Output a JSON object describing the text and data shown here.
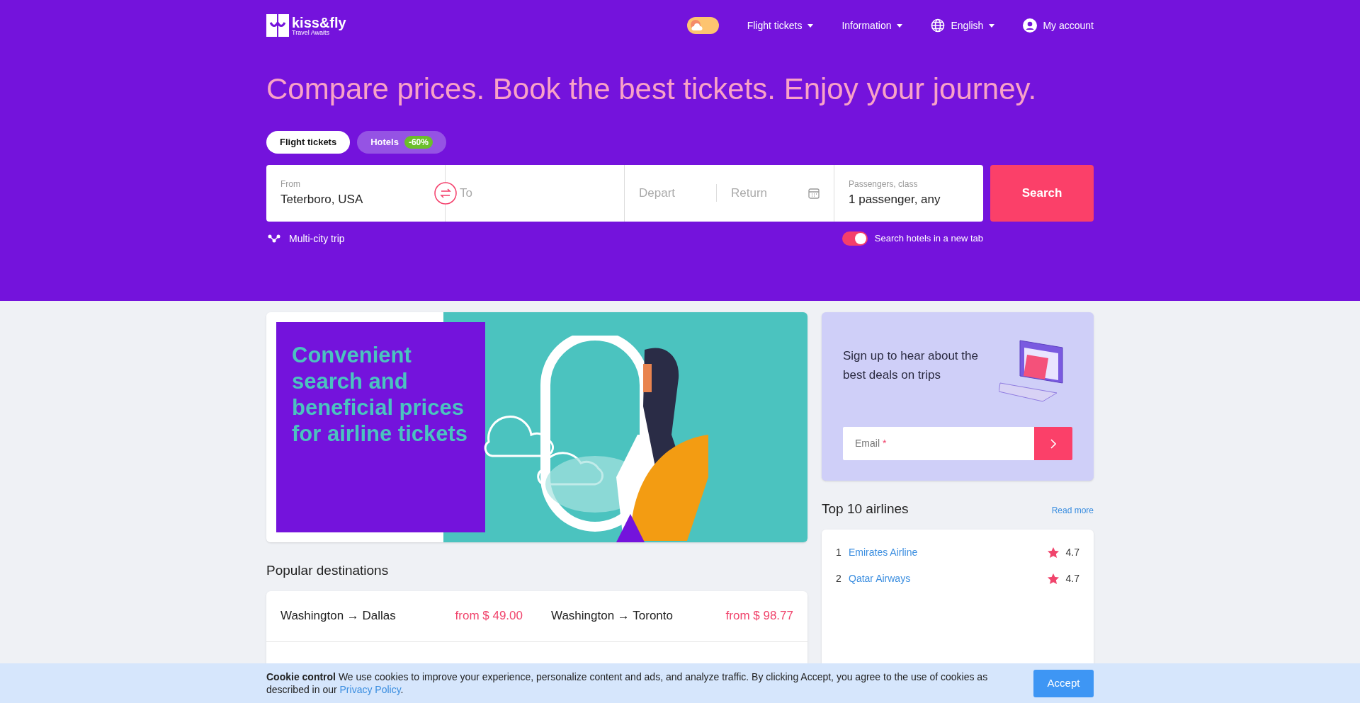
{
  "header": {
    "logo": {
      "name": "kiss&fly",
      "tagline": "Travel Awaits"
    },
    "nav": [
      {
        "label": "Flight tickets",
        "kind": "dropdown"
      },
      {
        "label": "Information",
        "kind": "dropdown"
      },
      {
        "label": "English",
        "kind": "language"
      },
      {
        "label": "My account",
        "kind": "account"
      }
    ]
  },
  "theme_toggle": {
    "on": false
  },
  "headline": "Compare prices. Book the best tickets. Enjoy your journey.",
  "search_tabs": [
    {
      "label": "Flight tickets",
      "selected": true
    },
    {
      "label": "Hotels",
      "badge": "-60%",
      "selected": false
    }
  ],
  "search_form": {
    "from": {
      "label": "From",
      "value": "Teterboro, USA"
    },
    "to": {
      "placeholder": "To"
    },
    "depart": {
      "placeholder": "Depart"
    },
    "return": {
      "placeholder": "Return"
    },
    "passengers": {
      "label": "Passengers, class",
      "value": "1 passenger, any"
    },
    "button": "Search"
  },
  "multi_city": "Multi-city trip",
  "hotels_toggle": {
    "label": "Search hotels in a new tab",
    "on": true
  },
  "banner": {
    "text": "Convenient search and beneficial prices for airline tickets"
  },
  "newsletter": {
    "text": "Sign up to hear about the best deals on trips",
    "email_placeholder": "Email",
    "required_mark": "*"
  },
  "popular_destinations": {
    "title": "Popular destinations",
    "routes": [
      {
        "route": "Washington → Dallas",
        "price": "from $ 49.00"
      },
      {
        "route": "Washington → Toronto",
        "price": "from $ 98.77"
      }
    ]
  },
  "top_airlines": {
    "title": "Top 10 airlines",
    "link": "Read more",
    "items": [
      {
        "rank": "1",
        "name": "Emirates Airline",
        "rating": "4.7"
      },
      {
        "rank": "2",
        "name": "Qatar Airways",
        "rating": "4.7"
      }
    ]
  },
  "cookie_bar": {
    "title": "Cookie control",
    "text": "We use cookies to improve your experience, personalize content and ads, and analyze traffic. By clicking Accept, you agree to the use of cookies as described in our",
    "link": "Privacy Policy",
    "end": ".",
    "button": "Accept"
  }
}
